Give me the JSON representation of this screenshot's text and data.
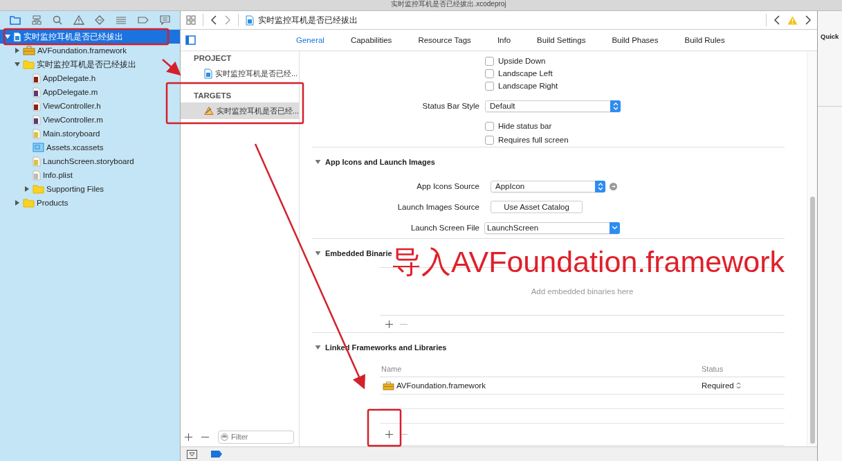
{
  "window": {
    "title": "实时监控耳机是否已经拔出.xcodeproj"
  },
  "navigator": {
    "tree": [
      {
        "name": "实时监控耳机是否已经拔出",
        "kind": "project",
        "expanded": true,
        "selected": true,
        "children": [
          {
            "name": "AVFoundation.framework",
            "kind": "framework",
            "expanded": false,
            "selected": false
          },
          {
            "name": "实时监控耳机是否已经拔出",
            "kind": "folder",
            "expanded": true,
            "selected": false,
            "children": [
              {
                "name": "AppDelegate.h",
                "kind": "header",
                "selected": false
              },
              {
                "name": "AppDelegate.m",
                "kind": "source",
                "selected": false
              },
              {
                "name": "ViewController.h",
                "kind": "header",
                "selected": false
              },
              {
                "name": "ViewController.m",
                "kind": "source",
                "selected": false
              },
              {
                "name": "Main.storyboard",
                "kind": "storyboard",
                "selected": false
              },
              {
                "name": "Assets.xcassets",
                "kind": "assets",
                "selected": false
              },
              {
                "name": "LaunchScreen.storyboard",
                "kind": "storyboard",
                "selected": false
              },
              {
                "name": "Info.plist",
                "kind": "plist",
                "selected": false
              },
              {
                "name": "Supporting Files",
                "kind": "folder",
                "expanded": false,
                "selected": false
              }
            ]
          },
          {
            "name": "Products",
            "kind": "folder",
            "expanded": false,
            "selected": false
          }
        ]
      }
    ]
  },
  "jump_bar": {
    "path": "实时监控耳机是否已经拔出"
  },
  "editor_tabs": [
    {
      "label": "General",
      "selected": true
    },
    {
      "label": "Capabilities",
      "selected": false
    },
    {
      "label": "Resource Tags",
      "selected": false
    },
    {
      "label": "Info",
      "selected": false
    },
    {
      "label": "Build Settings",
      "selected": false
    },
    {
      "label": "Build Phases",
      "selected": false
    },
    {
      "label": "Build Rules",
      "selected": false
    }
  ],
  "project_list": {
    "project_heading": "PROJECT",
    "project": [
      {
        "label": "实时监控耳机是否已经...",
        "kind": "project",
        "selected": false
      }
    ],
    "targets_heading": "TARGETS",
    "targets": [
      {
        "label": "实时监控耳机是否已经...",
        "kind": "app",
        "selected": true
      }
    ],
    "filter": {
      "placeholder": "Filter"
    }
  },
  "orientation_checks": [
    {
      "label": "Upside Down",
      "checked": false
    },
    {
      "label": "Landscape Left",
      "checked": false
    },
    {
      "label": "Landscape Right",
      "checked": false
    }
  ],
  "status_bar_style": {
    "label": "Status Bar Style",
    "value": "Default"
  },
  "status_checks": [
    {
      "label": "Hide status bar",
      "checked": false
    },
    {
      "label": "Requires full screen",
      "checked": false
    }
  ],
  "app_icons": {
    "title": "App Icons and Launch Images",
    "expanded": true,
    "rows": [
      {
        "label": "App Icons Source",
        "value": "AppIcon",
        "kind": "popup-arrow"
      },
      {
        "label": "Launch Images Source",
        "value": "Use Asset Catalog",
        "kind": "button"
      },
      {
        "label": "Launch Screen File",
        "value": "LaunchScreen",
        "kind": "combo"
      }
    ]
  },
  "embedded": {
    "title": "Embedded Binarie",
    "expanded": true,
    "empty_text": "Add embedded binaries here"
  },
  "linked": {
    "title": "Linked Frameworks and Libraries",
    "expanded": true,
    "columns": [
      "Name",
      "Status"
    ],
    "rows": [
      {
        "name": "AVFoundation.framework",
        "status": "Required"
      }
    ]
  },
  "inspector": {
    "title": "Quick"
  },
  "annotation": {
    "text": "导入AVFoundation.framework"
  }
}
